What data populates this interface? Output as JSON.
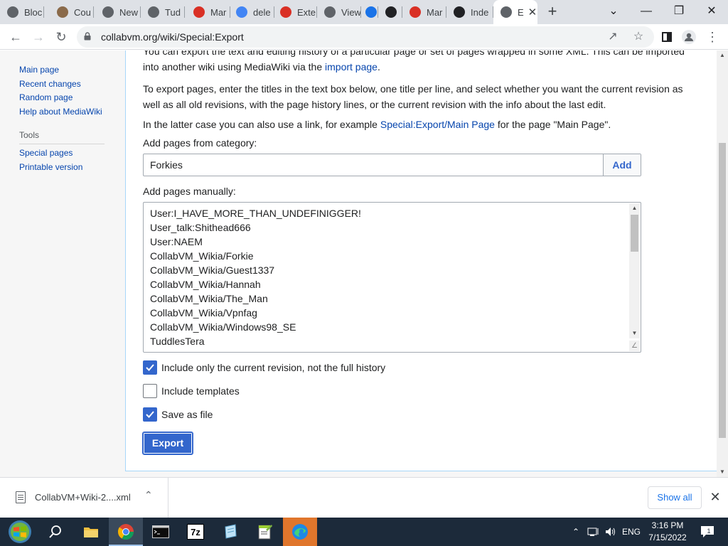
{
  "browser": {
    "tabs": [
      {
        "label": "Bloc",
        "icon": "globe-icon",
        "color": "#5f6368"
      },
      {
        "label": "Cou",
        "icon": "avatar-icon",
        "color": "#8a6a4a"
      },
      {
        "label": "New",
        "icon": "chrome-icon",
        "color": "#5f6368"
      },
      {
        "label": "Tud",
        "icon": "globe-icon",
        "color": "#5f6368"
      },
      {
        "label": "Mar",
        "icon": "opera-icon",
        "color": "#d93025"
      },
      {
        "label": "dele",
        "icon": "google-icon",
        "color": "#4285f4"
      },
      {
        "label": "Exte",
        "icon": "opera-icon",
        "color": "#d93025"
      },
      {
        "label": "View",
        "icon": "globe-icon",
        "color": "#5f6368"
      },
      {
        "label": "",
        "icon": "pin-icon",
        "color": "#1a73e8"
      },
      {
        "label": "",
        "icon": "anchor-icon",
        "color": "#202124"
      },
      {
        "label": "Mar",
        "icon": "opera-icon",
        "color": "#d93025"
      },
      {
        "label": "Inde",
        "icon": "wikipedia-icon",
        "color": "#202124"
      },
      {
        "label": "E",
        "icon": "globe-icon",
        "color": "#5f6368"
      }
    ],
    "url": "collabvm.org/wiki/Special:Export"
  },
  "sidebar": {
    "nav": [
      "Main page",
      "Recent changes",
      "Random page",
      "Help about MediaWiki"
    ],
    "tools_heading": "Tools",
    "tools": [
      "Special pages",
      "Printable version"
    ]
  },
  "export": {
    "intro_text": "You can export the text and editing history of a particular page or set of pages wrapped in some XML. This can be imported",
    "intro_line2_pre": "into another wiki using MediaWiki via the ",
    "intro_line2_link": "import page",
    "intro_line2_post": ".",
    "instructions": "To export pages, enter the titles in the text box below, one title per line, and select whether you want the current revision as well as all old revisions, with the page history lines, or the current revision with the info about the last edit.",
    "latter_pre": "In the latter case you can also use a link, for example ",
    "latter_link": "Special:Export/Main Page",
    "latter_post": " for the page \"Main Page\".",
    "category_label": "Add pages from category:",
    "category_value": "Forkies",
    "add_button": "Add",
    "manual_label": "Add pages manually:",
    "pages": [
      "User:I_HAVE_MORE_THAN_UNDEFINIGGER!",
      "User_talk:Shithead666",
      "User:NAEM",
      "CollabVM_Wikia/Forkie",
      "CollabVM_Wikia/Guest1337",
      "CollabVM_Wikia/Hannah",
      "CollabVM_Wikia/The_Man",
      "CollabVM_Wikia/Vpnfag",
      "CollabVM_Wikia/Windows98_SE",
      "TuddlesTera"
    ],
    "options": [
      {
        "label": "Include only the current revision, not the full history",
        "checked": true
      },
      {
        "label": "Include templates",
        "checked": false
      },
      {
        "label": "Save as file",
        "checked": true
      }
    ],
    "export_button": "Export"
  },
  "downloads": {
    "file_name": "CollabVM+Wiki-2....xml",
    "show_all": "Show all"
  },
  "taskbar": {
    "language": "ENG",
    "time": "3:16 PM",
    "date": "7/15/2022",
    "notification_count": "1"
  }
}
